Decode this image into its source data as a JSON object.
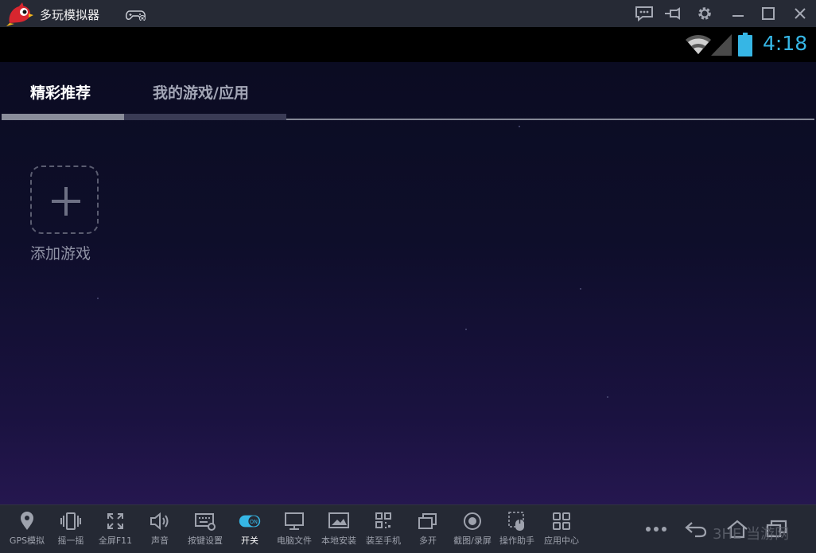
{
  "window": {
    "title": "多玩模拟器"
  },
  "statusbar": {
    "time": "4:18"
  },
  "tabs": [
    {
      "label": "精彩推荐",
      "active": true
    },
    {
      "label": "我的游戏/应用",
      "active": false
    }
  ],
  "add_game": {
    "label": "添加游戏"
  },
  "toolbar": {
    "items": [
      {
        "label": "GPS模拟",
        "icon": "location-pin-icon"
      },
      {
        "label": "摇一摇",
        "icon": "shake-icon"
      },
      {
        "label": "全屏F11",
        "icon": "fullscreen-icon"
      },
      {
        "label": "声音",
        "icon": "speaker-icon"
      },
      {
        "label": "按键设置",
        "icon": "keyboard-settings-icon"
      },
      {
        "label": "开关",
        "icon": "toggle-on-icon",
        "badge": "ON"
      },
      {
        "label": "电脑文件",
        "icon": "monitor-icon"
      },
      {
        "label": "本地安装",
        "icon": "install-icon"
      },
      {
        "label": "装至手机",
        "icon": "qr-phone-icon"
      },
      {
        "label": "多开",
        "icon": "multi-window-icon"
      },
      {
        "label": "截图/录屏",
        "icon": "record-icon"
      },
      {
        "label": "操作助手",
        "icon": "mouse-assist-icon"
      },
      {
        "label": "应用中心",
        "icon": "app-grid-icon"
      }
    ]
  },
  "watermark": "3HE 当游网",
  "colors": {
    "titlebar": "#262a35",
    "accent_clock": "#36b6e5",
    "toggle_on": "#36b6e5",
    "toolbar_bg": "#252934"
  }
}
